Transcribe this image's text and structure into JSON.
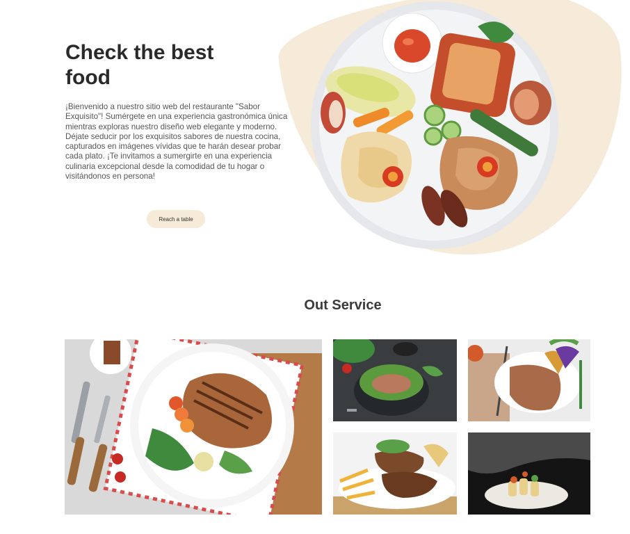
{
  "hero": {
    "title": "Check the best food",
    "description": "¡Bienvenido a nuestro sitio web del restaurante \"Sabor Exquisito\"! Sumérgete en una experiencia gastronómica única mientras exploras nuestro diseño web elegante y moderno. Déjate seducir por los exquisitos sabores de nuestra cocina, capturados en imágenes vívidas que te harán desear probar cada plato. ¡Te invitamos a sumergirte en una experiencia culinaria excepcional desde la comodidad de tu hogar o visitándonos en persona!",
    "button_label": "Reach a table"
  },
  "services": {
    "title": "Out Service"
  },
  "colors": {
    "accent": "#f6ead8",
    "heading": "#2a2a2a",
    "body_text": "#555555"
  }
}
